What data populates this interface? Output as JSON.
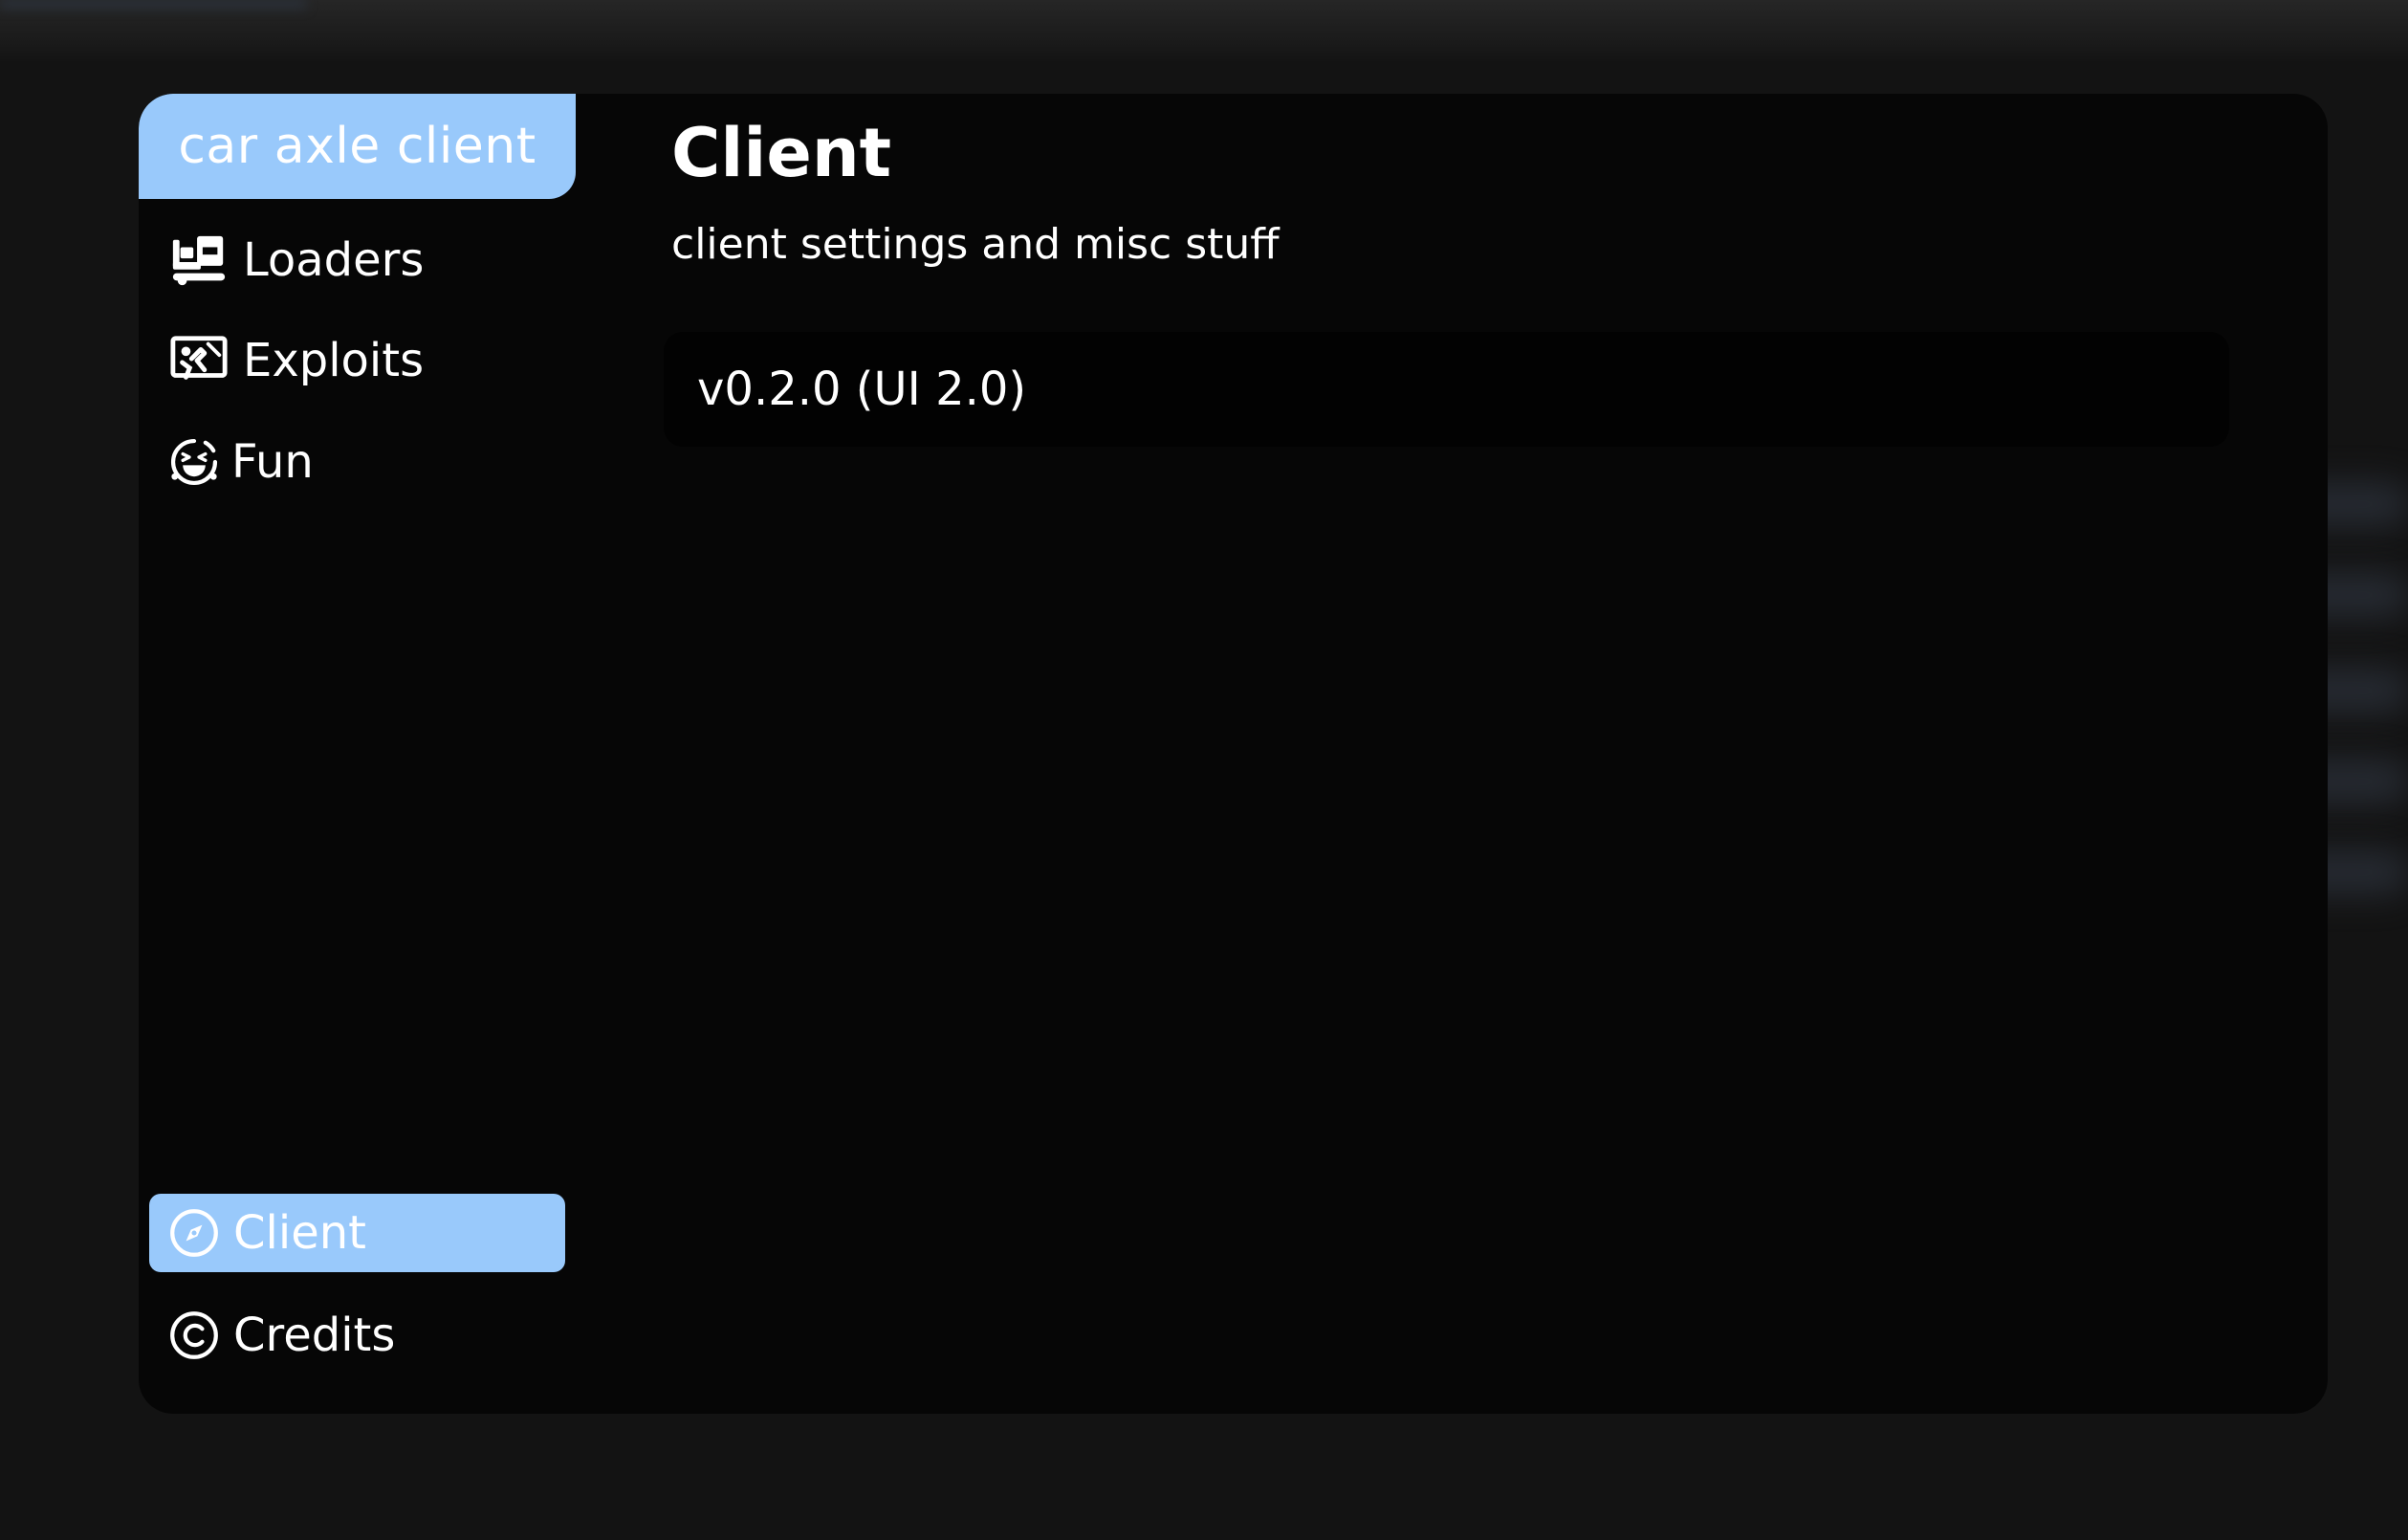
{
  "app": {
    "brand": "car axle client"
  },
  "sidebar": {
    "items": [
      {
        "label": "Loaders",
        "icon": "truck-loading-icon"
      },
      {
        "label": "Exploits",
        "icon": "person-falling-icon"
      },
      {
        "label": "Fun",
        "icon": "laughing-face-icon"
      }
    ],
    "bottom_items": [
      {
        "label": "Client",
        "icon": "compass-icon",
        "active": true
      },
      {
        "label": "Credits",
        "icon": "copyright-icon",
        "active": false
      }
    ]
  },
  "main": {
    "title": "Client",
    "subtitle": "client settings and misc stuff",
    "version": "v0.2.0 (UI 2.0)"
  },
  "colors": {
    "accent": "#99c9fb",
    "window_bg": "#060606",
    "card_bg": "#020202",
    "page_bg": "#131313",
    "text": "#ffffff"
  }
}
